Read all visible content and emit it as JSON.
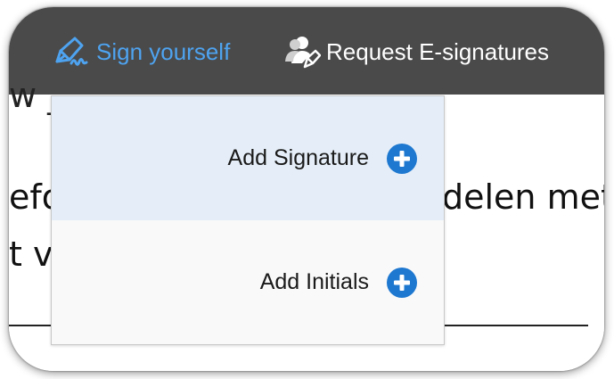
{
  "toolbar": {
    "sign_yourself": {
      "label": "Sign yourself",
      "icon": "pen-signature-icon",
      "color": "#4ea3f0"
    },
    "request_signatures": {
      "label": "Request E-signatures",
      "icon": "people-pen-icon",
      "color": "#ffffff"
    },
    "background": "#4a4a4a"
  },
  "document": {
    "top_text": "w ________ ",
    "left_line_1": "efo",
    "right_line_1": "delen met",
    "left_line_2": "t ve"
  },
  "dropdown": {
    "items": [
      {
        "label": "Add Signature",
        "icon": "plus-circle-icon"
      },
      {
        "label": "Add Initials",
        "icon": "plus-circle-icon"
      }
    ],
    "accent": "#1e78d0"
  }
}
